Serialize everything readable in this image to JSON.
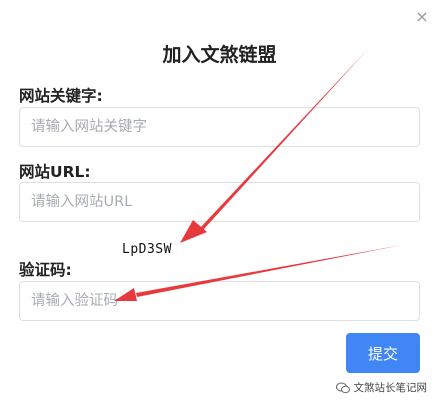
{
  "dialog": {
    "title": "加入文煞链盟",
    "close_glyph": "×"
  },
  "form": {
    "keyword_label": "网站关键字:",
    "keyword_placeholder": "请输入网站关键字",
    "url_label": "网站URL:",
    "url_placeholder": "请输入网站URL",
    "captcha_text": "LpD3SW",
    "captcha_label": "验证码:",
    "captcha_placeholder": "请输入验证码",
    "submit_label": "提交"
  },
  "watermark": {
    "text": "文煞站长笔记网"
  },
  "colors": {
    "primary": "#4186f5",
    "arrow": "#e8393d"
  }
}
